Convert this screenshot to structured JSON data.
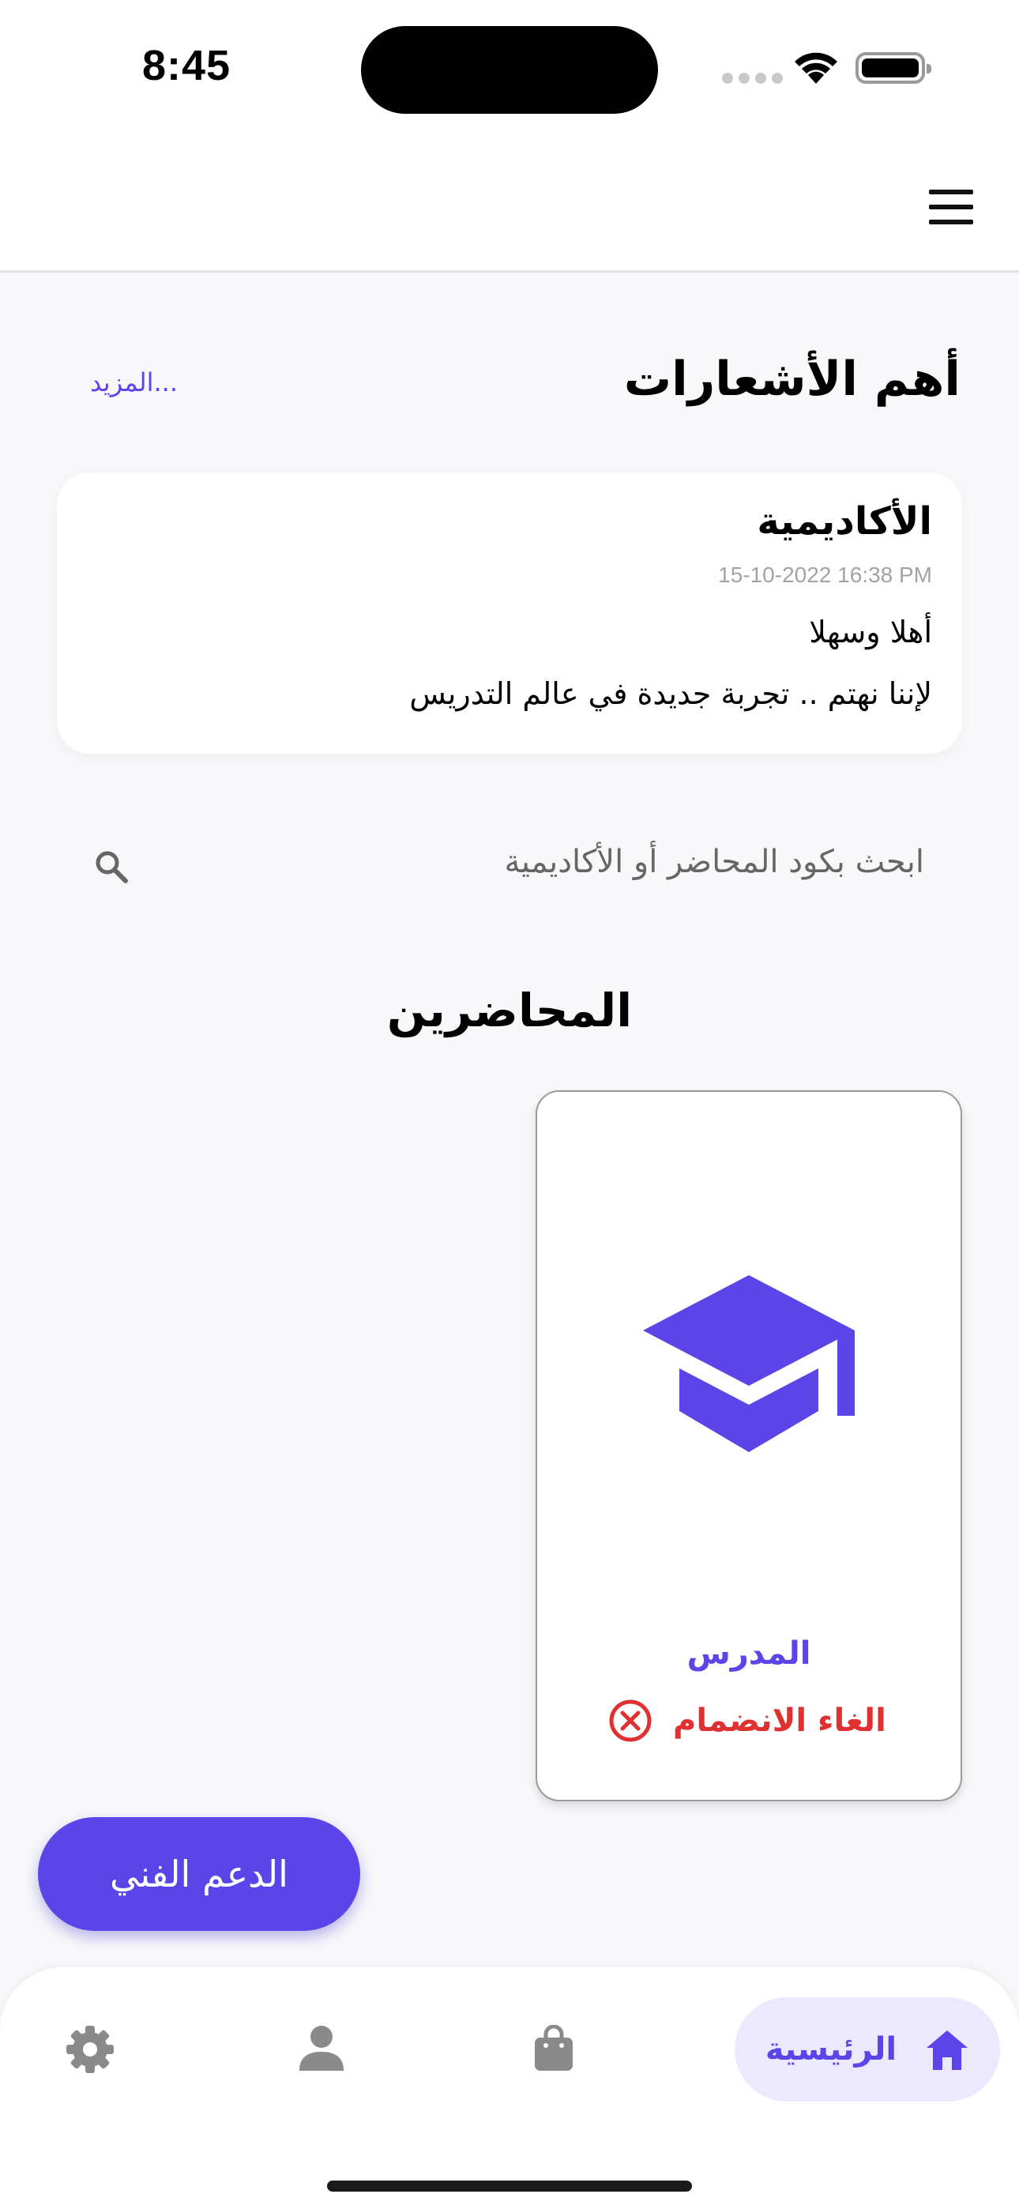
{
  "status_bar": {
    "time": "8:45"
  },
  "app_bar": {
    "menu_icon": "hamburger-menu-icon"
  },
  "announcements": {
    "title": "أهم الأشعارات",
    "more_label": "المزيد...",
    "card": {
      "title": "الأكاديمية",
      "date": "15-10-2022 16:38 PM",
      "line1": "أهلا وسهلا",
      "line2": "لإننا نهتم .. تجربة جديدة في عالم التدريس"
    }
  },
  "search": {
    "placeholder": "ابحث بكود المحاضر أو الأكاديمية",
    "icon": "search-icon"
  },
  "instructors": {
    "title": "المحاضرين",
    "cards": [
      {
        "icon": "graduation-cap-icon",
        "name": "المدرس",
        "action_label": "الغاء الانضمام",
        "action_icon": "cancel-circle-icon"
      }
    ]
  },
  "support_button": {
    "label": "الدعم الفني"
  },
  "bottom_nav": {
    "items": [
      {
        "label": "الرئيسية",
        "icon": "home-icon",
        "active": true
      },
      {
        "label": "",
        "icon": "shopping-bag-icon",
        "active": false
      },
      {
        "label": "",
        "icon": "person-icon",
        "active": false
      },
      {
        "label": "",
        "icon": "gear-icon",
        "active": false
      }
    ]
  },
  "colors": {
    "accent": "#5b45e8",
    "accent_light": "#ece9ff",
    "danger": "#e03131",
    "background": "#f8f8fa",
    "muted_icon": "#8a8a8a"
  }
}
